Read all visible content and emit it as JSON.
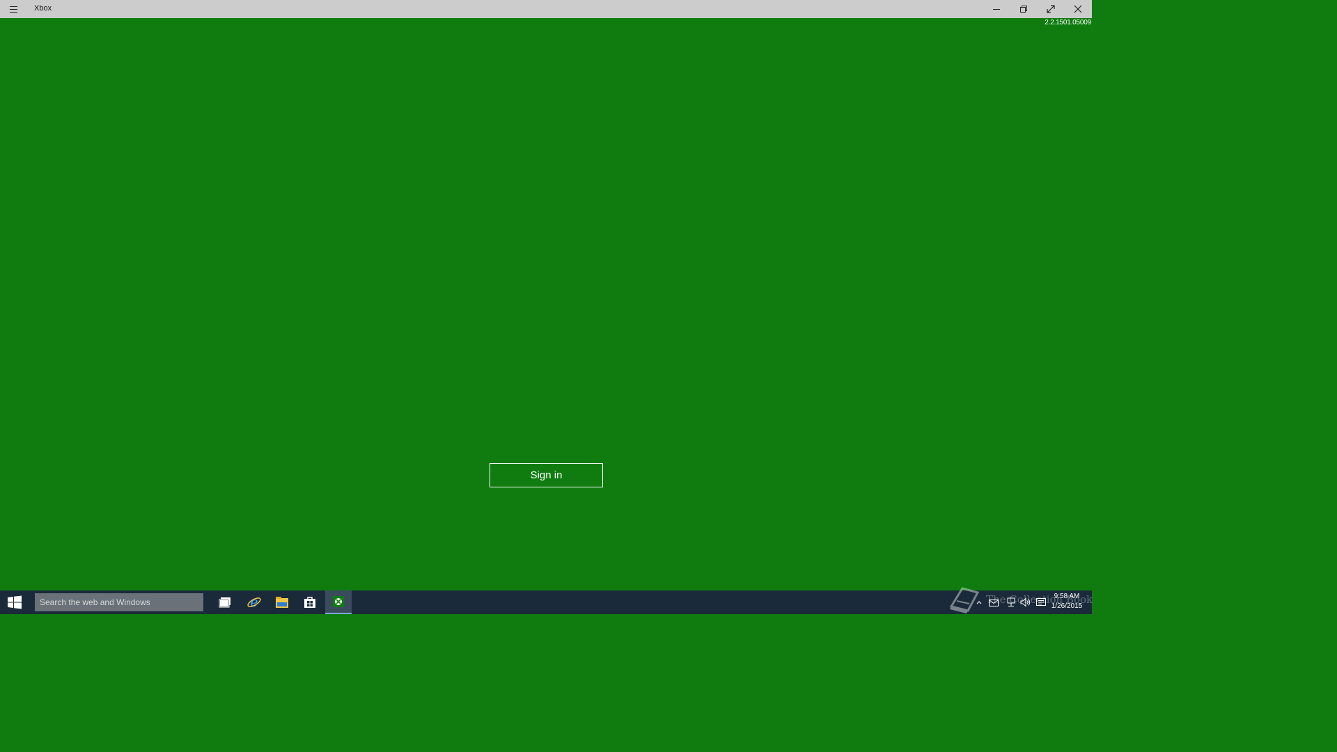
{
  "titlebar": {
    "app_title": "Xbox",
    "menu_icon": "hamburger-icon",
    "controls": [
      "minimize-icon",
      "restore-icon",
      "fullscreen-icon",
      "close-icon"
    ]
  },
  "app": {
    "version": "2.2.1501.05009",
    "signin_label": "Sign in",
    "background_color": "#107c10"
  },
  "taskbar": {
    "search_placeholder": "Search the web and Windows",
    "icons": [
      "windows-start-icon",
      "task-view-icon",
      "internet-explorer-icon",
      "file-explorer-icon",
      "store-icon",
      "xbox-icon"
    ],
    "tray_icons": [
      "chevron-up-icon",
      "mail-icon",
      "network-icon",
      "volume-icon",
      "action-center-icon"
    ],
    "clock": {
      "time": "9:58 AM",
      "date": "1/26/2015"
    },
    "watermark_text": "The Collection Book",
    "background_color": "#1b2a3a"
  }
}
